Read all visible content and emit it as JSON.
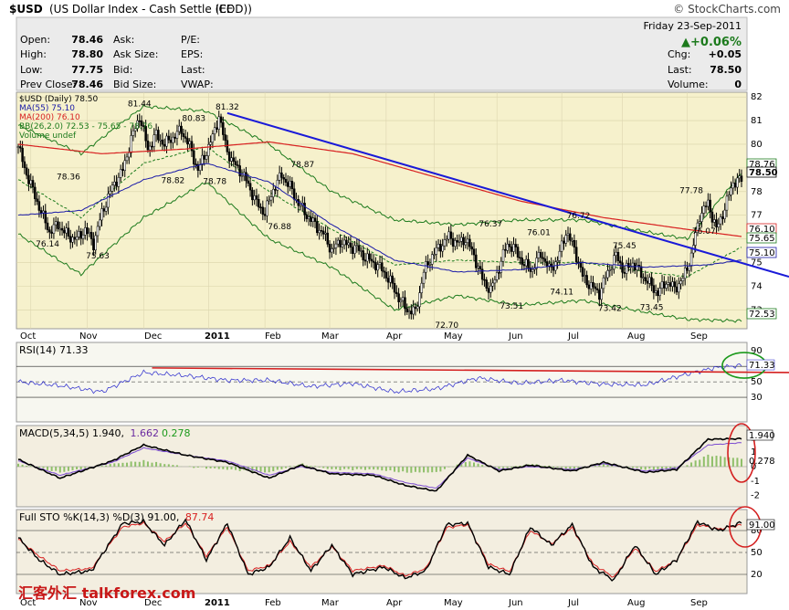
{
  "header": {
    "symbol": "$USD",
    "description": "(US Dollar Index - Cash Settle (EOD))",
    "exchange": "ICE",
    "watermark": "© StockCharts.com",
    "date": "Friday 23-Sep-2011",
    "pct_change": "+0.06%"
  },
  "quote": {
    "open": {
      "label": "Open:",
      "value": "78.46"
    },
    "high": {
      "label": "High:",
      "value": "78.80"
    },
    "low": {
      "label": "Low:",
      "value": "77.75"
    },
    "prev_close": {
      "label": "Prev Close:",
      "value": "78.46"
    },
    "ask": {
      "label": "Ask:",
      "value": ""
    },
    "ask_size": {
      "label": "Ask Size:",
      "value": ""
    },
    "bid": {
      "label": "Bid:",
      "value": ""
    },
    "bid_size": {
      "label": "Bid Size:",
      "value": ""
    },
    "pe": {
      "label": "P/E:",
      "value": ""
    },
    "eps": {
      "label": "EPS:",
      "value": ""
    },
    "last_c": {
      "label": "Last:",
      "value": ""
    },
    "vwap": {
      "label": "VWAP:",
      "value": ""
    },
    "chg": {
      "label": "Chg:",
      "value": "+0.05"
    },
    "last": {
      "label": "Last:",
      "value": "78.50"
    },
    "volume": {
      "label": "Volume:",
      "value": "0"
    }
  },
  "legend": {
    "price": "$USD (Daily) 78.50",
    "ma55": "MA(55) 75.10",
    "ma200": "MA(200) 76.10",
    "bb": "BB(26,2.0) 72.53 - 75.65 - 78.76",
    "volume": "Volume undef"
  },
  "panels": {
    "rsi": {
      "title": "RSI(14) 71.33",
      "value_label": "71.33"
    },
    "macd": {
      "title_prefix": "MACD(5,34,5) 1.940,",
      "signal": "1.662",
      "hist": "0.278",
      "value_label": "1.940",
      "hist_label": "0.278"
    },
    "sto": {
      "title_prefix": "Full STO %K(14,3) %D(3) 91.00,",
      "d": "87.74",
      "value_label": "91.00"
    }
  },
  "footer_logo": "汇客外汇 talkforex.com",
  "colors": {
    "price_bg": "#f6f1cc",
    "panel_bg": "#f7f7f0",
    "bars": "#000000",
    "ma55": "#1a1aa8",
    "ma200": "#d82020",
    "bb": "#1c7a1c",
    "trendline": "#1a1ad8",
    "rsi_line": "#3b3bd0",
    "highlight": "#d42020",
    "circle_green": "#1c9a1c"
  },
  "chart_data": {
    "type": "ohlc",
    "period": "daily",
    "months": [
      "Oct",
      "Nov",
      "Dec",
      "2011",
      "Feb",
      "Mar",
      "Apr",
      "May",
      "Jun",
      "Jul",
      "Aug",
      "Sep"
    ],
    "y_ticks": [
      73,
      74,
      75,
      76,
      77,
      78,
      79,
      80,
      81,
      82
    ],
    "ylim": [
      72.2,
      82.2
    ],
    "right_labels": [
      "78.76",
      "78.50",
      "76.10",
      "75.65",
      "75.10",
      "72.53"
    ],
    "close_key": [
      [
        0,
        79.9
      ],
      [
        3,
        79.0
      ],
      [
        8,
        77.8
      ],
      [
        12,
        76.9
      ],
      [
        15,
        76.3
      ],
      [
        19,
        76.6
      ],
      [
        24,
        76.1
      ],
      [
        28,
        76.0
      ],
      [
        32,
        76.4
      ],
      [
        36,
        75.8
      ],
      [
        40,
        77.1
      ],
      [
        45,
        78.2
      ],
      [
        50,
        78.9
      ],
      [
        54,
        80.2
      ],
      [
        58,
        81.2
      ],
      [
        62,
        79.8
      ],
      [
        66,
        80.4
      ],
      [
        70,
        80.0
      ],
      [
        74,
        80.3
      ],
      [
        78,
        80.6
      ],
      [
        82,
        79.9
      ],
      [
        86,
        78.9
      ],
      [
        90,
        79.7
      ],
      [
        93,
        80.3
      ],
      [
        96,
        81.2
      ],
      [
        99,
        80.0
      ],
      [
        102,
        79.3
      ],
      [
        106,
        78.9
      ],
      [
        110,
        78.3
      ],
      [
        114,
        77.5
      ],
      [
        118,
        77.1
      ],
      [
        122,
        78.1
      ],
      [
        126,
        78.7
      ],
      [
        130,
        78.2
      ],
      [
        134,
        77.5
      ],
      [
        138,
        77.0
      ],
      [
        142,
        76.6
      ],
      [
        146,
        76.2
      ],
      [
        150,
        75.5
      ],
      [
        154,
        75.9
      ],
      [
        158,
        75.7
      ],
      [
        162,
        75.6
      ],
      [
        166,
        75.2
      ],
      [
        170,
        75.0
      ],
      [
        174,
        74.7
      ],
      [
        178,
        74.2
      ],
      [
        182,
        73.5
      ],
      [
        186,
        73.0
      ],
      [
        190,
        72.9
      ],
      [
        194,
        74.6
      ],
      [
        198,
        75.3
      ],
      [
        202,
        75.7
      ],
      [
        206,
        76.1
      ],
      [
        210,
        75.8
      ],
      [
        214,
        76.0
      ],
      [
        218,
        75.3
      ],
      [
        222,
        74.3
      ],
      [
        226,
        73.8
      ],
      [
        230,
        74.8
      ],
      [
        234,
        75.8
      ],
      [
        238,
        75.5
      ],
      [
        242,
        74.9
      ],
      [
        246,
        74.7
      ],
      [
        250,
        75.4
      ],
      [
        254,
        74.7
      ],
      [
        258,
        75.1
      ],
      [
        262,
        76.3
      ],
      [
        266,
        75.6
      ],
      [
        270,
        74.4
      ],
      [
        274,
        74.0
      ],
      [
        278,
        73.7
      ],
      [
        282,
        74.6
      ],
      [
        286,
        75.3
      ],
      [
        290,
        74.6
      ],
      [
        294,
        75.0
      ],
      [
        298,
        74.5
      ],
      [
        302,
        74.1
      ],
      [
        306,
        73.7
      ],
      [
        310,
        74.2
      ],
      [
        314,
        73.9
      ],
      [
        318,
        74.3
      ],
      [
        322,
        75.3
      ],
      [
        326,
        77.0
      ],
      [
        330,
        77.5
      ],
      [
        334,
        76.4
      ],
      [
        338,
        77.3
      ],
      [
        342,
        78.4
      ],
      [
        346,
        78.5
      ]
    ],
    "ma55_key": [
      [
        0,
        77.0
      ],
      [
        30,
        77.2
      ],
      [
        60,
        78.5
      ],
      [
        90,
        79.2
      ],
      [
        120,
        78.4
      ],
      [
        150,
        76.6
      ],
      [
        180,
        75.1
      ],
      [
        210,
        74.6
      ],
      [
        240,
        74.7
      ],
      [
        270,
        75.0
      ],
      [
        300,
        74.8
      ],
      [
        330,
        74.9
      ],
      [
        346,
        75.1
      ]
    ],
    "ma200_key": [
      [
        0,
        80.0
      ],
      [
        40,
        79.6
      ],
      [
        80,
        79.8
      ],
      [
        120,
        80.1
      ],
      [
        160,
        79.6
      ],
      [
        200,
        78.6
      ],
      [
        240,
        77.6
      ],
      [
        280,
        76.9
      ],
      [
        320,
        76.4
      ],
      [
        346,
        76.1
      ]
    ],
    "bb_upper_key": [
      [
        0,
        80.8
      ],
      [
        30,
        79.6
      ],
      [
        60,
        81.6
      ],
      [
        90,
        81.4
      ],
      [
        120,
        80.0
      ],
      [
        150,
        78.0
      ],
      [
        180,
        76.8
      ],
      [
        210,
        76.6
      ],
      [
        240,
        76.8
      ],
      [
        270,
        76.8
      ],
      [
        300,
        76.3
      ],
      [
        320,
        76.0
      ],
      [
        346,
        78.76
      ]
    ],
    "bb_mid_key": [
      [
        0,
        78.5
      ],
      [
        30,
        76.9
      ],
      [
        60,
        79.2
      ],
      [
        90,
        79.9
      ],
      [
        120,
        78.0
      ],
      [
        150,
        76.4
      ],
      [
        180,
        74.9
      ],
      [
        210,
        75.1
      ],
      [
        240,
        75.0
      ],
      [
        270,
        75.0
      ],
      [
        300,
        74.6
      ],
      [
        320,
        74.4
      ],
      [
        346,
        75.65
      ]
    ],
    "bb_lower_key": [
      [
        0,
        76.2
      ],
      [
        30,
        74.5
      ],
      [
        60,
        76.9
      ],
      [
        90,
        78.4
      ],
      [
        120,
        76.0
      ],
      [
        150,
        74.8
      ],
      [
        180,
        73.0
      ],
      [
        210,
        73.6
      ],
      [
        240,
        73.2
      ],
      [
        270,
        73.4
      ],
      [
        300,
        72.9
      ],
      [
        320,
        72.6
      ],
      [
        346,
        72.53
      ]
    ],
    "trendline": {
      "start": [
        100,
        81.32
      ],
      "end_value": 74.4
    },
    "annotations": [
      {
        "label": "81.44",
        "i": 58,
        "v": 81.44,
        "dy": -4
      },
      {
        "label": "81.32",
        "i": 100,
        "v": 81.32,
        "dy": -4
      },
      {
        "label": "80.83",
        "i": 84,
        "v": 80.83,
        "dy": -4
      },
      {
        "label": "78.36",
        "i": 24,
        "v": 78.36,
        "dy": -4
      },
      {
        "label": "78.87",
        "i": 136,
        "v": 78.87,
        "dy": -4
      },
      {
        "label": "78.82",
        "i": 74,
        "v": 78.82,
        "dy": 12
      },
      {
        "label": "78.78",
        "i": 94,
        "v": 78.78,
        "dy": 12
      },
      {
        "label": "76.14",
        "i": 14,
        "v": 76.14,
        "dy": 12
      },
      {
        "label": "75.63",
        "i": 38,
        "v": 75.63,
        "dy": 12
      },
      {
        "label": "76.88",
        "i": 125,
        "v": 76.88,
        "dy": 12
      },
      {
        "label": "76.37",
        "i": 226,
        "v": 76.37,
        "dy": -4
      },
      {
        "label": "76.01",
        "i": 249,
        "v": 76.01,
        "dy": -4
      },
      {
        "label": "76.72",
        "i": 268,
        "v": 76.72,
        "dy": -4
      },
      {
        "label": "75.45",
        "i": 290,
        "v": 75.45,
        "dy": -4
      },
      {
        "label": "77.78",
        "i": 322,
        "v": 77.78,
        "dy": -4
      },
      {
        "label": "76.07",
        "i": 328,
        "v": 76.07,
        "dy": -4
      },
      {
        "label": "72.70",
        "i": 205,
        "v": 72.7,
        "dy": 12
      },
      {
        "label": "73.51",
        "i": 236,
        "v": 73.51,
        "dy": 12
      },
      {
        "label": "74.11",
        "i": 260,
        "v": 74.11,
        "dy": 12
      },
      {
        "label": "73.42",
        "i": 283,
        "v": 73.42,
        "dy": 12
      },
      {
        "label": "73.45",
        "i": 303,
        "v": 73.45,
        "dy": 12
      }
    ],
    "rsi": {
      "ticks": [
        30,
        50,
        70,
        90
      ],
      "key": [
        [
          0,
          50
        ],
        [
          20,
          45
        ],
        [
          40,
          37
        ],
        [
          60,
          62
        ],
        [
          80,
          58
        ],
        [
          100,
          52
        ],
        [
          120,
          52
        ],
        [
          140,
          44
        ],
        [
          160,
          48
        ],
        [
          180,
          37
        ],
        [
          200,
          41
        ],
        [
          220,
          55
        ],
        [
          240,
          48
        ],
        [
          260,
          52
        ],
        [
          280,
          47
        ],
        [
          300,
          46
        ],
        [
          320,
          60
        ],
        [
          333,
          68
        ],
        [
          346,
          71.33
        ]
      ],
      "resistance": {
        "from": [
          64,
          68
        ],
        "to": [
          346,
          62
        ]
      }
    },
    "macd": {
      "ticks": [
        -2,
        -1,
        0,
        1,
        2
      ],
      "macd_key": [
        [
          0,
          0.5
        ],
        [
          20,
          -0.8
        ],
        [
          45,
          0.4
        ],
        [
          60,
          1.5
        ],
        [
          80,
          0.8
        ],
        [
          100,
          0.3
        ],
        [
          120,
          -0.8
        ],
        [
          135,
          0.1
        ],
        [
          150,
          -0.5
        ],
        [
          170,
          -0.6
        ],
        [
          185,
          -1.3
        ],
        [
          200,
          -1.7
        ],
        [
          215,
          0.8
        ],
        [
          230,
          -0.3
        ],
        [
          245,
          0.1
        ],
        [
          265,
          -0.3
        ],
        [
          280,
          0.3
        ],
        [
          300,
          -0.4
        ],
        [
          315,
          -0.2
        ],
        [
          330,
          1.9
        ],
        [
          346,
          1.94
        ]
      ],
      "signal_key": [
        [
          0,
          0.4
        ],
        [
          20,
          -0.6
        ],
        [
          45,
          0.3
        ],
        [
          60,
          1.3
        ],
        [
          80,
          0.8
        ],
        [
          100,
          0.4
        ],
        [
          120,
          -0.6
        ],
        [
          135,
          0.0
        ],
        [
          150,
          -0.4
        ],
        [
          170,
          -0.5
        ],
        [
          185,
          -1.1
        ],
        [
          200,
          -1.5
        ],
        [
          215,
          0.6
        ],
        [
          230,
          -0.2
        ],
        [
          245,
          0.0
        ],
        [
          265,
          -0.2
        ],
        [
          280,
          0.2
        ],
        [
          300,
          -0.3
        ],
        [
          315,
          -0.1
        ],
        [
          330,
          1.5
        ],
        [
          346,
          1.662
        ]
      ]
    },
    "sto": {
      "ticks": [
        20,
        50,
        80
      ],
      "k_key": [
        [
          0,
          70
        ],
        [
          10,
          40
        ],
        [
          20,
          20
        ],
        [
          35,
          25
        ],
        [
          50,
          90
        ],
        [
          60,
          92
        ],
        [
          70,
          60
        ],
        [
          80,
          95
        ],
        [
          90,
          40
        ],
        [
          100,
          90
        ],
        [
          110,
          20
        ],
        [
          120,
          30
        ],
        [
          130,
          70
        ],
        [
          140,
          25
        ],
        [
          150,
          60
        ],
        [
          160,
          20
        ],
        [
          175,
          30
        ],
        [
          185,
          15
        ],
        [
          195,
          25
        ],
        [
          205,
          88
        ],
        [
          215,
          90
        ],
        [
          225,
          30
        ],
        [
          235,
          20
        ],
        [
          245,
          85
        ],
        [
          255,
          60
        ],
        [
          265,
          88
        ],
        [
          275,
          30
        ],
        [
          285,
          12
        ],
        [
          295,
          60
        ],
        [
          305,
          20
        ],
        [
          315,
          40
        ],
        [
          325,
          92
        ],
        [
          335,
          80
        ],
        [
          346,
          91
        ]
      ],
      "d_key": [
        [
          0,
          68
        ],
        [
          10,
          45
        ],
        [
          20,
          25
        ],
        [
          35,
          28
        ],
        [
          50,
          85
        ],
        [
          60,
          90
        ],
        [
          70,
          65
        ],
        [
          80,
          90
        ],
        [
          90,
          45
        ],
        [
          100,
          85
        ],
        [
          110,
          25
        ],
        [
          120,
          32
        ],
        [
          130,
          65
        ],
        [
          140,
          30
        ],
        [
          150,
          58
        ],
        [
          160,
          25
        ],
        [
          175,
          32
        ],
        [
          185,
          18
        ],
        [
          195,
          28
        ],
        [
          205,
          84
        ],
        [
          215,
          88
        ],
        [
          225,
          34
        ],
        [
          235,
          24
        ],
        [
          245,
          80
        ],
        [
          255,
          62
        ],
        [
          265,
          84
        ],
        [
          275,
          34
        ],
        [
          285,
          16
        ],
        [
          295,
          56
        ],
        [
          305,
          24
        ],
        [
          315,
          40
        ],
        [
          325,
          88
        ],
        [
          335,
          82
        ],
        [
          346,
          87.74
        ]
      ]
    }
  }
}
